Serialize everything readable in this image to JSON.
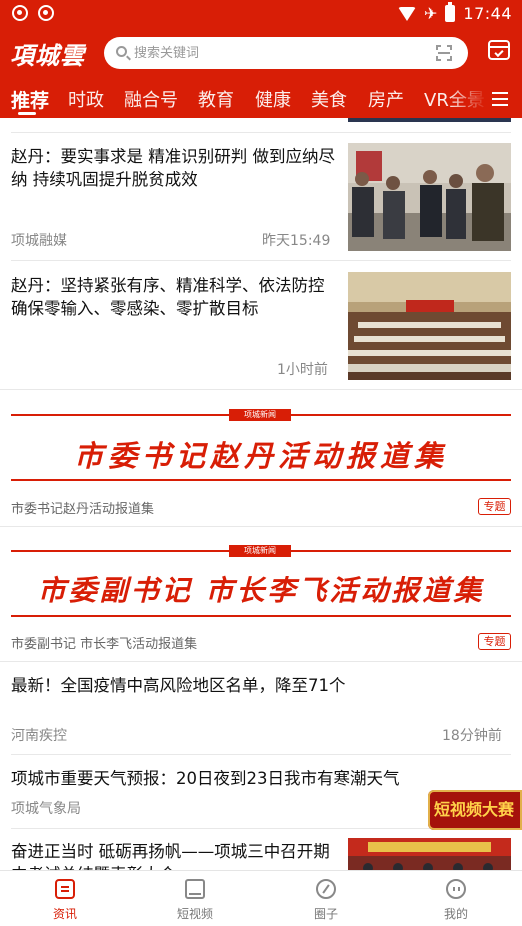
{
  "status_bar": {
    "time": "17:44"
  },
  "header": {
    "logo": "項城雲",
    "search_placeholder": "搜索关键词"
  },
  "nav_tabs": [
    {
      "label": "推荐",
      "active": true
    },
    {
      "label": "时政"
    },
    {
      "label": "融合号"
    },
    {
      "label": "教育"
    },
    {
      "label": "健康"
    },
    {
      "label": "美食"
    },
    {
      "label": "房产"
    },
    {
      "label": "VR全景"
    }
  ],
  "feed": {
    "articles": [
      {
        "title": "赵丹：要实事求是 精准识别研判 做到应纳尽纳 持续巩固提升脱贫成效",
        "source": "项城融媒",
        "time": "昨天15:49"
      },
      {
        "title": "赵丹：坚持紧张有序、精准科学、依法防控 确保零输入、零感染、零扩散目标",
        "time": "1小时前"
      }
    ],
    "topics": [
      {
        "banner_tag": "项城新闻",
        "banner_title": "市委书记赵丹活动报道集",
        "caption": "市委书记赵丹活动报道集",
        "badge": "专题"
      },
      {
        "banner_tag": "项城新闻",
        "banner_title": "市委副书记 市长李飞活动报道集",
        "caption": "市委副书记 市长李飞活动报道集",
        "badge": "专题"
      }
    ],
    "articles_more": [
      {
        "title": "最新！全国疫情中高风险地区名单，降至71个",
        "source": "河南疾控",
        "time": "18分钟前"
      },
      {
        "title": "项城市重要天气预报：20日夜到23日我市有寒潮天气",
        "source": "项城气象局"
      },
      {
        "title": "奋进正当时 砥砺再扬帆——项城三中召开期中考试总结暨表彰大会"
      }
    ],
    "float_ad": "短视频大赛"
  },
  "bottom_nav": [
    {
      "label": "资讯",
      "icon": "news-icon",
      "active": true
    },
    {
      "label": "短视频",
      "icon": "video-icon"
    },
    {
      "label": "圈子",
      "icon": "compass-icon"
    },
    {
      "label": "我的",
      "icon": "profile-icon"
    }
  ],
  "colors": {
    "brand_red": "#d81e06"
  }
}
